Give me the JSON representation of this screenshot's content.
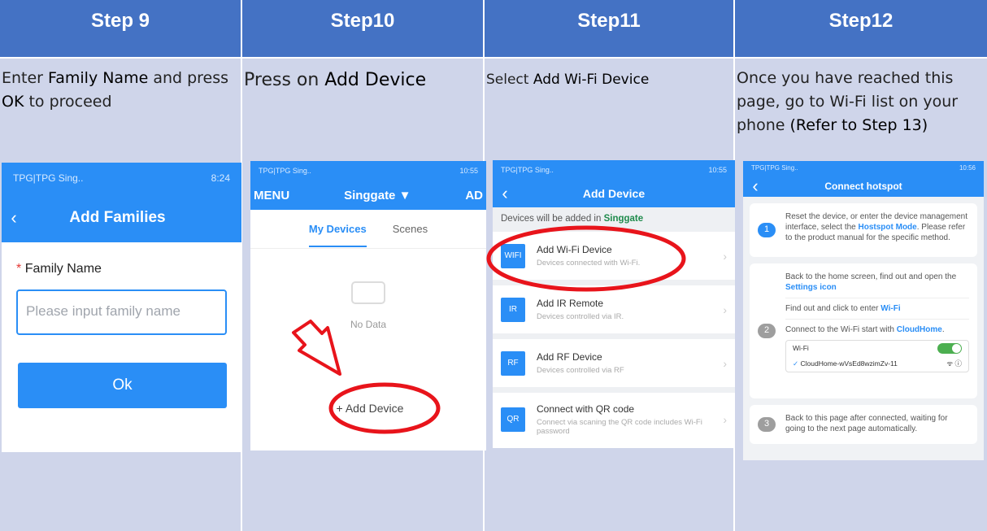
{
  "steps": [
    {
      "heading": "Step 9",
      "desc": [
        {
          "t": "Enter ",
          "b": false
        },
        {
          "t": "Family Name",
          "b": true
        },
        {
          "t": " and press ",
          "b": false
        },
        {
          "t": "OK",
          "b": true
        },
        {
          "t": " to proceed",
          "b": false
        }
      ]
    },
    {
      "heading": "Step10",
      "desc": [
        {
          "t": "Press on ",
          "b": false
        },
        {
          "t": "Add Device",
          "b": true
        }
      ]
    },
    {
      "heading": "Step11",
      "desc": [
        {
          "t": "Select ",
          "b": false
        },
        {
          "t": "Add Wi-Fi Device",
          "b": true
        }
      ]
    },
    {
      "heading": "Step12",
      "desc": [
        {
          "t": "Once you have reached this page, go to Wi-Fi list on your phone ",
          "b": false
        },
        {
          "t": "(Refer to Step 13)",
          "b": true
        }
      ]
    }
  ],
  "phone9": {
    "status_left": "TPG|TPG Sing..",
    "status_right": "8:24",
    "title": "Add Families",
    "field_label": "Family Name",
    "required_mark": "*",
    "placeholder": "Please input family name",
    "ok": "Ok"
  },
  "phone10": {
    "status_left": "TPG|TPG Sing..",
    "status_right": "10:55",
    "menu": "MENU",
    "title": "Singgate ▼",
    "right_cut": "AD",
    "tab_active": "My Devices",
    "tab_other": "Scenes",
    "empty_text": "No Data",
    "add_button": "+ Add Device"
  },
  "phone11": {
    "status_left": "TPG|TPG Sing..",
    "status_right": "10:55",
    "title": "Add Device",
    "info_prefix": "Devices will be added in ",
    "info_family": "Singgate",
    "rows": [
      {
        "badge": "WIFI",
        "title": "Add Wi-Fi Device",
        "sub": "Devices connected with Wi-Fi."
      },
      {
        "badge": "IR",
        "title": "Add IR Remote",
        "sub": "Devices controlled via IR."
      },
      {
        "badge": "RF",
        "title": "Add RF Device",
        "sub": "Devices controlled via RF"
      },
      {
        "badge": "QR",
        "title": "Connect with QR code",
        "sub": "Connect via scaning the QR code includes Wi-Fi password"
      }
    ]
  },
  "phone12": {
    "status_left": "TPG|TPG Sing..",
    "status_right": "10:56",
    "title": "Connect hotspot",
    "c1_a": "Reset the device, or enter the device management interface, select the ",
    "c1_b": "Hostspot Mode",
    "c1_c": ". Please refer to the product manual for the specific method.",
    "c2_a": "Back to the home screen, find out and open the ",
    "c2_b": "Settings icon",
    "c2_d": "Find out and click to enter ",
    "c2_e": "Wi-Fi",
    "c2_f": "Connect to the Wi-Fi start with ",
    "c2_g": "CloudHome",
    "c2_h": ".",
    "wifi_label": "Wi-Fi",
    "network": "CloudHome-wVsEd8wzimZv-11",
    "c3": "Back to this page after connected, waiting for going to the next page automatically.",
    "num1": "1",
    "num2": "2",
    "num3": "3"
  },
  "colors": {
    "header": "#4472c4",
    "cell": "#cfd5ea",
    "accent": "#2a8ef6",
    "annotation": "#e8141b"
  }
}
